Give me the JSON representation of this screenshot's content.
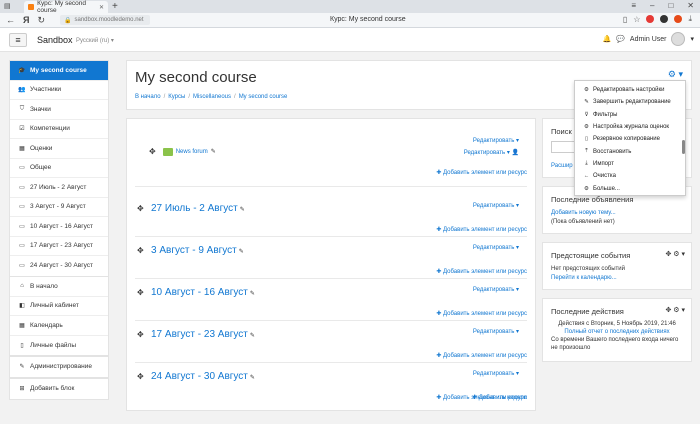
{
  "browser": {
    "tab_title": "Курс: My second course",
    "address": "sandbox.moodledemo.net",
    "page_title": "Курс: My second course",
    "yandex_letter": "Я"
  },
  "navbar": {
    "brand": "Sandbox",
    "language": "Русский (ru) ▾",
    "user_name": "Admin User"
  },
  "drawer": {
    "group1": [
      {
        "icon": "graduation-cap-icon",
        "label": "My second course",
        "active": true
      },
      {
        "icon": "users-icon",
        "label": "Участники"
      },
      {
        "icon": "shield-icon",
        "label": "Значки"
      },
      {
        "icon": "check-square-icon",
        "label": "Компетенции"
      },
      {
        "icon": "table-icon",
        "label": "Оценки"
      },
      {
        "icon": "folder-icon",
        "label": "Общее"
      },
      {
        "icon": "folder-icon",
        "label": "27 Июль - 2 Август"
      },
      {
        "icon": "folder-icon",
        "label": "3 Август - 9 Август"
      },
      {
        "icon": "folder-icon",
        "label": "10 Август - 16 Август"
      },
      {
        "icon": "folder-icon",
        "label": "17 Август - 23 Август"
      },
      {
        "icon": "folder-icon",
        "label": "24 Август - 30 Август"
      }
    ],
    "group2": [
      {
        "icon": "home-icon",
        "label": "В начало"
      },
      {
        "icon": "dashboard-icon",
        "label": "Личный кабинет"
      },
      {
        "icon": "calendar-icon",
        "label": "Календарь"
      },
      {
        "icon": "file-icon",
        "label": "Личные файлы"
      }
    ],
    "group3": [
      {
        "icon": "wrench-icon",
        "label": "Администрирование"
      }
    ],
    "group4": [
      {
        "icon": "plus-square-icon",
        "label": "Добавить блок"
      }
    ]
  },
  "header": {
    "title": "My second course",
    "breadcrumb": [
      "В начало",
      "Курсы",
      "Miscellaneous",
      "My second course"
    ]
  },
  "content": {
    "edit_label": "Редактировать ▾",
    "add_label": "Добавить элемент или ресурс",
    "add_week_label": "Добавить недели",
    "forum_name": "News forum",
    "sections": [
      "27 Июль - 2 Август",
      "3 Август - 9 Август",
      "10 Август - 16 Август",
      "17 Август - 23 Август",
      "24 Август - 30 Август"
    ]
  },
  "blocks": {
    "search": {
      "title": "Поиск",
      "advanced": "Расшир"
    },
    "news": {
      "title": "Последние объявления",
      "link": "Добавить новую тему...",
      "note": "(Пока объявлений нет)"
    },
    "events": {
      "title": "Предстоящие события",
      "note": "Нет предстоящих событий",
      "link": "Перейти к календарю..."
    },
    "activity": {
      "title": "Последние действия",
      "since": "Действия с Вторник, 5 Ноябрь 2019, 21:46",
      "report": "Полный отчет о последних действиях",
      "note_line1": "Со времени Вашего последнего входа ничего",
      "note_line2": "не произошло"
    }
  },
  "menu": [
    {
      "icon": "gear-icon",
      "label": "Редактировать настройки"
    },
    {
      "icon": "pencil-icon",
      "label": "Завершить редактирование"
    },
    {
      "icon": "filter-icon",
      "label": "Фильтры"
    },
    {
      "icon": "gear-icon",
      "label": "Настройка журнала оценок"
    },
    {
      "icon": "file-icon",
      "label": "Резервное копирование"
    },
    {
      "icon": "upload-icon",
      "label": "Восстановить"
    },
    {
      "icon": "download-icon",
      "label": "Импорт"
    },
    {
      "icon": "arrow-left-icon",
      "label": "Очистка"
    },
    {
      "icon": "gear-icon",
      "label": "Больше..."
    }
  ],
  "colors": {
    "accent": "#1177d1",
    "background": "#f2f2f2"
  }
}
